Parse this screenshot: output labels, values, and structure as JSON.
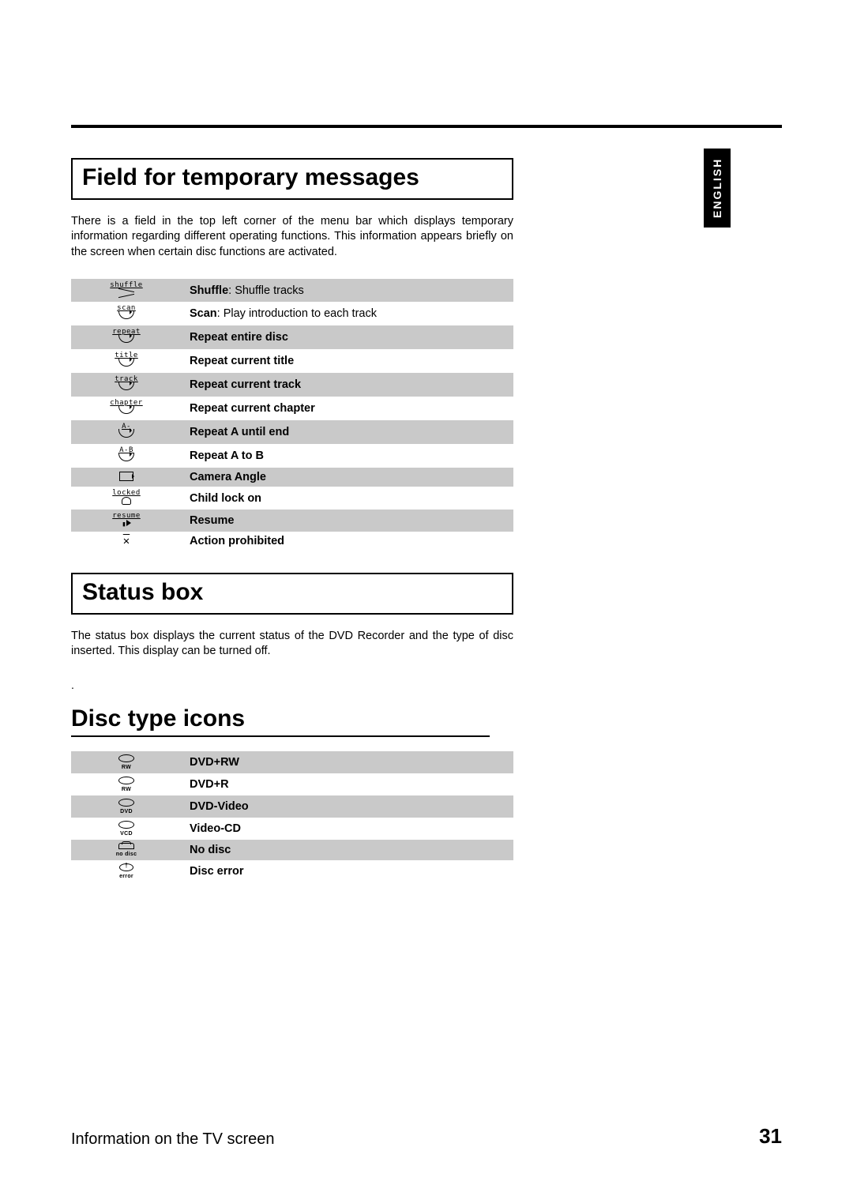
{
  "language_tab": "ENGLISH",
  "section_temp_messages": {
    "heading": "Field for temporary messages",
    "paragraph": "There is a field in the top left corner of the menu bar which displays temporary information regarding different operating functions. This information appears briefly on the screen when certain disc functions are activated."
  },
  "temp_table": [
    {
      "icon_text": "shuffle",
      "label_bold": "Shuffle",
      "label_rest": ": Shuffle tracks"
    },
    {
      "icon_text": "scan",
      "label_bold": "Scan",
      "label_rest": ": Play introduction to each track"
    },
    {
      "icon_text": "repeat",
      "label_bold": "Repeat entire disc",
      "label_rest": ""
    },
    {
      "icon_text": "title",
      "label_bold": "Repeat current title",
      "label_rest": ""
    },
    {
      "icon_text": "track",
      "label_bold": "Repeat current track",
      "label_rest": ""
    },
    {
      "icon_text": "chapter",
      "label_bold": "Repeat current chapter",
      "label_rest": ""
    },
    {
      "icon_text": "A-",
      "label_bold": "Repeat A until end",
      "label_rest": ""
    },
    {
      "icon_text": "A-B",
      "label_bold": "Repeat A to B",
      "label_rest": ""
    },
    {
      "icon_text": "",
      "label_bold": "Camera Angle",
      "label_rest": ""
    },
    {
      "icon_text": "locked",
      "label_bold": "Child lock on",
      "label_rest": ""
    },
    {
      "icon_text": "resume",
      "label_bold": "Resume",
      "label_rest": ""
    },
    {
      "icon_text": "",
      "label_bold": "Action prohibited",
      "label_rest": ""
    }
  ],
  "section_status_box": {
    "heading": "Status box",
    "paragraph": "The status box displays the current status of the DVD Recorder and the type of disc inserted. This display can be turned off."
  },
  "dot_line": ".",
  "section_disc_icons": {
    "heading": "Disc type icons"
  },
  "disc_table": [
    {
      "sub": "RW",
      "label": "DVD+RW"
    },
    {
      "sub": "RW",
      "label": "DVD+R"
    },
    {
      "sub": "DVD",
      "label": "DVD-Video"
    },
    {
      "sub": "VCD",
      "label": "Video-CD"
    },
    {
      "sub": "no disc",
      "label": "No disc"
    },
    {
      "sub": "error",
      "label": "Disc error"
    }
  ],
  "footer": {
    "left": "Information on the TV screen",
    "right": "31"
  }
}
